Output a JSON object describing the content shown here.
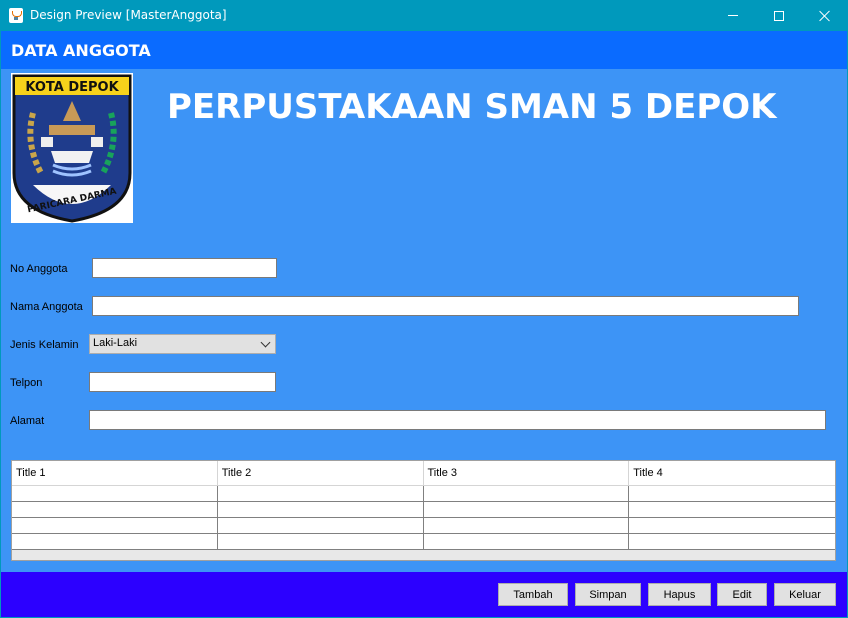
{
  "window": {
    "title": "Design Preview [MasterAnggota]",
    "icon": "java-icon"
  },
  "header": {
    "title": "DATA ANGGOTA"
  },
  "logo": {
    "top_text": "KOTA DEPOK",
    "motto": "PARICARA DARMA",
    "colors": {
      "shield": "#1f3c8c",
      "top": "#f7d21b",
      "border": "#111111"
    }
  },
  "banner": {
    "text": "PERPUSTAKAAN SMAN 5 DEPOK"
  },
  "form": {
    "no_anggota": {
      "label": "No Anggota",
      "value": ""
    },
    "nama_anggota": {
      "label": "Nama Anggota",
      "value": ""
    },
    "jenis_kelamin": {
      "label": "Jenis Kelamin",
      "value": "Laki-Laki"
    },
    "telpon": {
      "label": "Telpon",
      "value": ""
    },
    "alamat": {
      "label": "Alamat",
      "value": ""
    }
  },
  "table": {
    "columns": [
      "Title 1",
      "Title 2",
      "Title 3",
      "Title 4"
    ]
  },
  "buttons": {
    "tambah": "Tambah",
    "simpan": "Simpan",
    "hapus": "Hapus",
    "edit": "Edit",
    "keluar": "Keluar"
  },
  "colors": {
    "titlebar": "#0099bc",
    "header": "#0a6bff",
    "panel": "#3d94f6",
    "footer": "#2c00ff"
  }
}
